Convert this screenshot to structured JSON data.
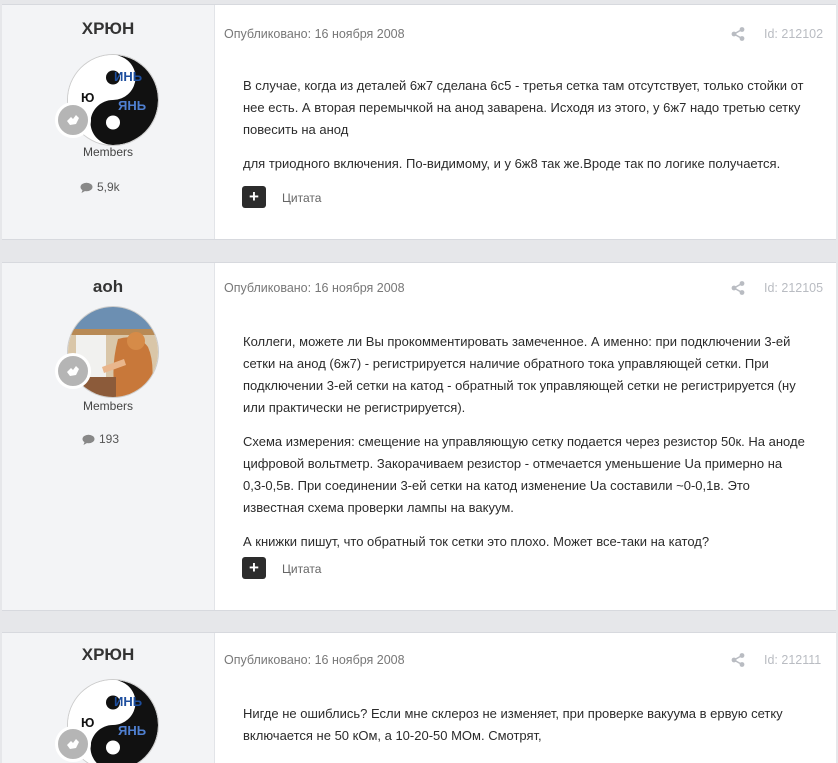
{
  "posts": [
    {
      "author": "ХРЮН",
      "avatar_text": [
        "ИНЬ",
        "Ю",
        "ЯНЬ"
      ],
      "group": "Members",
      "post_count": "5,9k",
      "published": "Опубликовано: 16 ноября 2008",
      "post_id": "Id: 212102",
      "paragraphs": [
        "В случае, когда из деталей 6ж7 сделана 6с5 - третья сетка там отсутствует, только стойки от нее есть. А вторая перемычкой на анод заварена. Исходя из этого, у 6ж7 надо третью сетку повесить на анод",
        "для триодного включения. По-видимому, и у 6ж8 так же.Вроде так по логике получается."
      ],
      "quote_label": "Цитата"
    },
    {
      "author": "aoh",
      "group": "Members",
      "post_count": "193",
      "published": "Опубликовано: 16 ноября 2008",
      "post_id": "Id: 212105",
      "paragraphs": [
        "Коллеги, можете ли Вы прокомментировать замеченное. А именно: при подключении 3-ей сетки на анод (6ж7) - регистрируется наличие обратного тока управляющей сетки. При подключении 3-ей сетки на катод - обратный ток управляющей сетки не регистрируется (ну или практически не регистрируется).",
        "Схема измерения: смещение на управляющую сетку подается через резистор 50к. На аноде цифровой вольтметр. Закорачиваем резистор - отмечается уменьшение Ua примерно на 0,3-0,5в. При соединении 3-ей сетки на катод изменение Ua составили ~0-0,1в. Это известная схема проверки лампы на вакуум.",
        "А книжки пишут, что обратный ток сетки это плохо. Может все-таки на катод?"
      ],
      "quote_label": "Цитата"
    },
    {
      "author": "ХРЮН",
      "avatar_text": [
        "ИНЬ",
        "Ю",
        "ЯНЬ"
      ],
      "published": "Опубликовано: 16 ноября 2008",
      "post_id": "Id: 212111",
      "paragraphs": [
        "Нигде не ошиблись? Если мне склероз не изменяет, при проверке вакуума в ервую сетку включается не 50 кОм, а 10-20-50 МОм. Смотрят,"
      ]
    }
  ],
  "colors": {
    "page_bg": "#e6e7ea",
    "author_bg": "#f3f4f6",
    "post_bg": "#ffffff",
    "meta_text": "#777777",
    "quote_button": "#2c2c2c"
  },
  "icons": {
    "share": "share-icon",
    "comment": "comment-icon",
    "badge": "rank-badge-icon",
    "quote": "plus-icon"
  }
}
